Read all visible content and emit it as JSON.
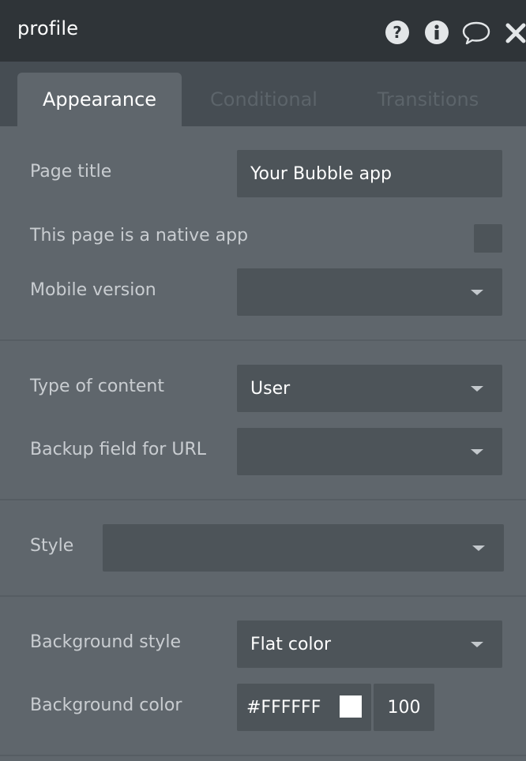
{
  "header": {
    "title": "profile",
    "icons": [
      "question-circle-icon",
      "info-circle-icon",
      "comment-icon",
      "close-icon"
    ]
  },
  "tabs": [
    {
      "label": "Appearance",
      "active": true
    },
    {
      "label": "Conditional",
      "active": false
    },
    {
      "label": "Transitions",
      "active": false
    }
  ],
  "fields": {
    "page_title": {
      "label": "Page title",
      "value": "Your Bubble app"
    },
    "native_app": {
      "label": "This page is a native app",
      "checked": false
    },
    "mobile_version": {
      "label": "Mobile version",
      "value": ""
    },
    "type_of_content": {
      "label": "Type of content",
      "value": "User"
    },
    "backup_field": {
      "label": "Backup field for URL",
      "value": ""
    },
    "style": {
      "label": "Style",
      "value": ""
    },
    "background_style": {
      "label": "Background style",
      "value": "Flat color"
    },
    "background_color": {
      "label": "Background color",
      "hex": "#FFFFFF",
      "opacity": "100"
    }
  },
  "colors": {
    "panel_bg": "#5f666c",
    "titlebar_bg": "#2f3438",
    "tabsbar_bg": "#464d53",
    "field_bg": "#4d5459",
    "swatch": "#ffffff"
  }
}
